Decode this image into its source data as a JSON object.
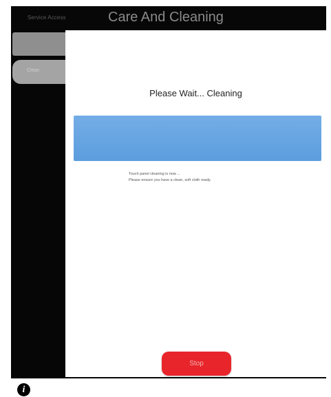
{
  "header": {
    "back_label": "Service Access",
    "title": "Care And Cleaning"
  },
  "sidebar": {
    "items": [
      {
        "label": ""
      },
      {
        "label": "Clean"
      }
    ]
  },
  "main": {
    "status_title": "Please Wait... Cleaning",
    "progress_fraction": 1.0,
    "instructions": [
      "Touch panel cleaning is now ...",
      "Please ensure you have a clean, soft cloth ready."
    ],
    "stop_label": "Stop"
  },
  "footer": {
    "info_icon": "info-icon",
    "info_glyph": "i"
  },
  "colors": {
    "progress": "#5c9dde",
    "stop_button": "#e8252b",
    "screen_background": "#060606"
  }
}
